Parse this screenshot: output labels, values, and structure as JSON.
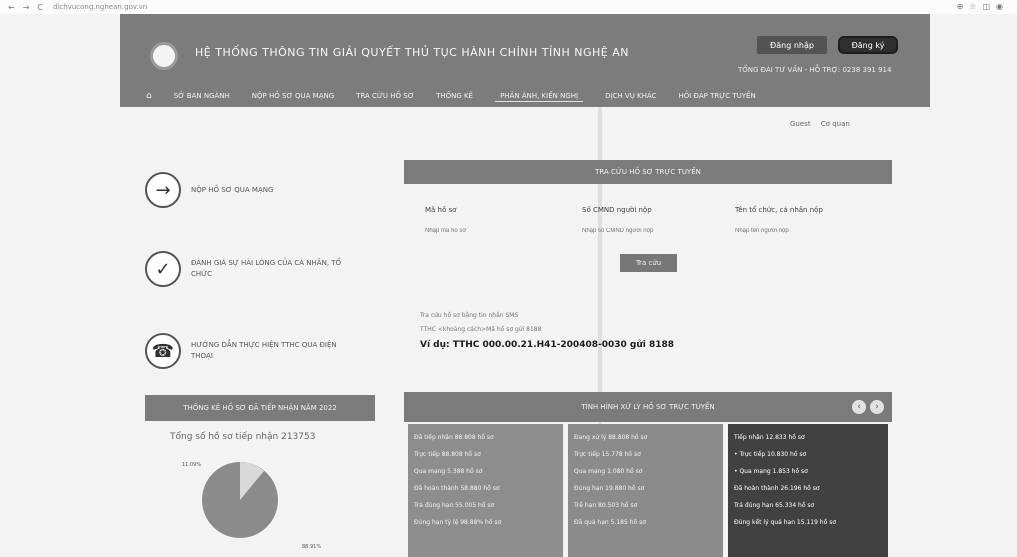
{
  "browser": {
    "url": "dichvucong.nghean.gov.vn"
  },
  "header": {
    "title": "HỆ THỐNG THÔNG TIN GIẢI QUYẾT THỦ TỤC HÀNH CHÍNH TỈNH NGHỆ AN",
    "login_label": "Đăng nhập",
    "register_label": "Đăng ký",
    "hotline": "TỔNG ĐÀI TƯ VẤN - HỖ TRỢ: 0238 391 914"
  },
  "nav": {
    "home_icon": "home-icon",
    "items": [
      "SỞ BAN NGÀNH",
      "NỘP HỒ SƠ QUA MẠNG",
      "TRA CỨU HỒ SƠ",
      "THỐNG KÊ",
      "PHẢN ÁNH, KIẾN NGHỊ",
      "DỊCH VỤ KHÁC",
      "HỎI ĐÁP TRỰC TUYẾN"
    ],
    "active_index": 4
  },
  "user": {
    "guest": "Guest",
    "agency": "Cơ quan"
  },
  "features": [
    {
      "label": "NỘP HỒ SƠ QUA MẠNG",
      "icon": "arrow-right-icon"
    },
    {
      "label": "ĐÁNH GIÁ SỰ HÀI LÒNG CỦA CÁ NHÂN, TỔ CHỨC",
      "icon": "check-icon"
    },
    {
      "label": "HƯỚNG DẪN THỰC HIỆN TTHC QUA ĐIỆN THOẠI",
      "icon": "phone-icon"
    }
  ],
  "search": {
    "title": "TRA CỨU HỒ SƠ TRỰC TUYẾN",
    "fields": [
      {
        "label": "Mã hồ sơ",
        "placeholder": "Nhập mã hồ sơ"
      },
      {
        "label": "Số CMND người nộp",
        "placeholder": "Nhập số CMND người nộp"
      },
      {
        "label": "Tên tổ chức, cá nhân nộp",
        "placeholder": "Nhập tên người nộp"
      }
    ],
    "button": "Tra cứu",
    "hint1": "Tra cứu hồ sơ bằng tin nhắn SMS",
    "hint2": "TTHC <khoảng cách>Mã hồ sơ gửi 8188",
    "example": "Ví dụ: TTHC 000.00.21.H41-200408-0030 gửi 8188"
  },
  "stats": {
    "title": "THỐNG KÊ HỒ SƠ ĐÃ TIẾP NHẬN NĂM 2022",
    "total": "Tổng số hồ sơ tiếp nhận 213753",
    "pie_label_a": "11.09%",
    "pie_label_b": "88.91%"
  },
  "processing": {
    "title": "TÌNH HÌNH XỬ LÝ HỒ SƠ TRỰC TUYẾN",
    "col1": [
      "Đã tiếp nhận 88.808 hồ sơ",
      "Trực tiếp 88.808 hồ sơ",
      "Qua mạng 5.388 hồ sơ",
      "Đã hoàn thành 58.880 hồ sơ",
      "Trả đúng hạn 55.005 hồ sơ",
      "Đúng hạn tỷ lệ 98.88% hồ sơ"
    ],
    "col2": [
      "Đang xử lý 88.808 hồ sơ",
      "Trực tiếp 15.778 hồ sơ",
      "Qua mạng 1.080 hồ sơ",
      "Đúng hạn 19.880 hồ sơ",
      "Trễ hạn 80.503 hồ sơ",
      "Đã quá hạn 5.185 hồ sơ"
    ],
    "col3": [
      "Tiếp nhận 12.833 hồ sơ",
      "• Trực tiếp 10.830 hồ sơ",
      "• Qua mạng 1.853 hồ sơ",
      "Đã hoàn thành 26.196 hồ sơ",
      "Trả đúng hạn 65.334 hồ sơ",
      "Đúng kết lý quá hạn 15.119 hồ sơ"
    ]
  }
}
